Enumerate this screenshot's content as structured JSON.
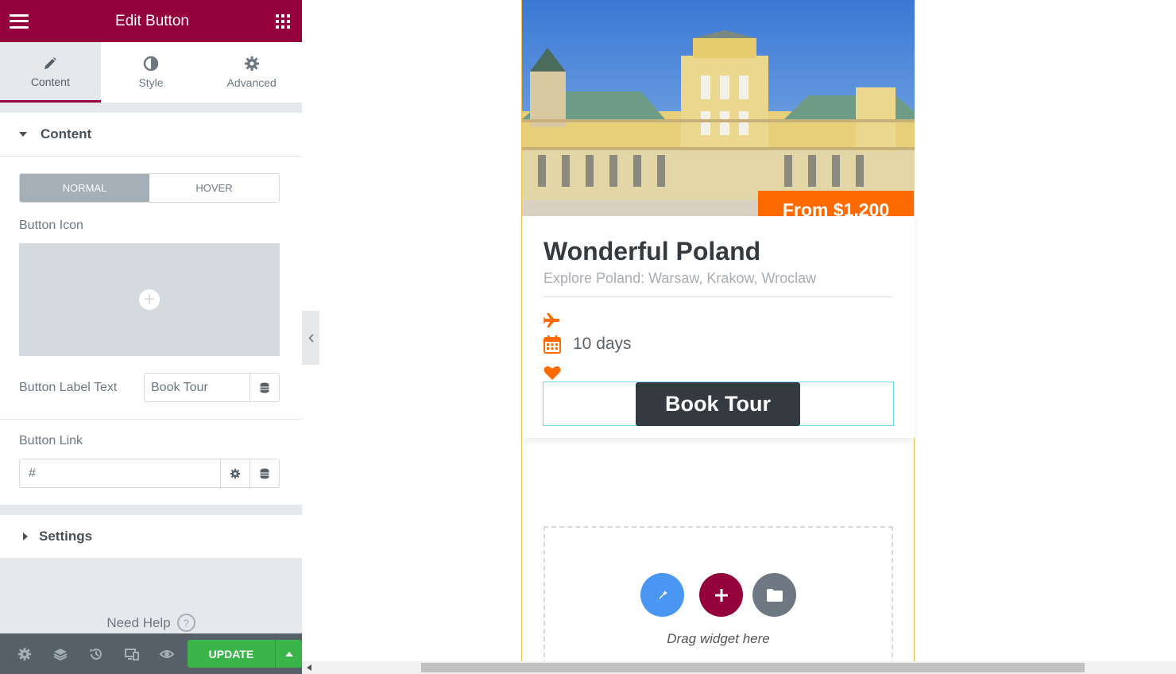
{
  "panel": {
    "title": "Edit Button",
    "tabs": [
      {
        "label": "Content",
        "icon": "pencil-icon",
        "active": true
      },
      {
        "label": "Style",
        "icon": "contrast-icon",
        "active": false
      },
      {
        "label": "Advanced",
        "icon": "gear-icon",
        "active": false
      }
    ],
    "content_section": {
      "title": "Content",
      "state_toggle": {
        "normal": "NORMAL",
        "hover": "HOVER",
        "selected": "NORMAL"
      },
      "button_icon_label": "Button Icon",
      "button_label_text_label": "Button Label Text",
      "button_label_text_value": "Book Tour",
      "button_link_label": "Button Link",
      "button_link_value": "#"
    },
    "settings_section": {
      "title": "Settings"
    },
    "need_help": "Need Help",
    "update_label": "UPDATE",
    "accent_color": "#93003c",
    "update_color": "#39b54a"
  },
  "canvas": {
    "price_badge": "From $1,200",
    "tour_title": "Wonderful Poland",
    "tour_subtitle": "Explore Poland: Warsaw, Krakow, Wroclaw",
    "duration": "10 days",
    "book_button": "Book Tour",
    "drop_zone_text": "Drag widget here",
    "accent_color": "#ff6a00"
  }
}
